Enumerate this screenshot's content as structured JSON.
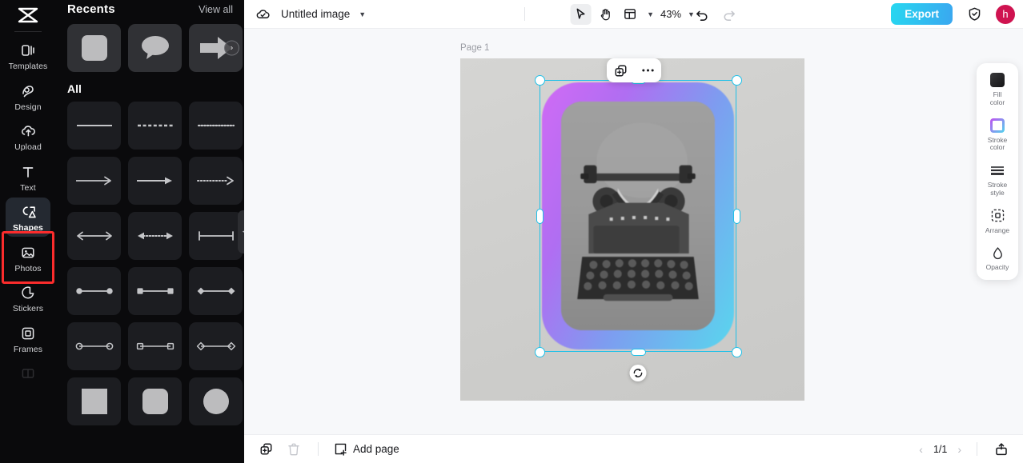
{
  "app": {
    "logo_icon": "capcut-logo-icon"
  },
  "sidebar": {
    "items": [
      {
        "label": "Templates",
        "icon": "templates-icon"
      },
      {
        "label": "Design",
        "icon": "design-icon"
      },
      {
        "label": "Upload",
        "icon": "upload-cloud-icon"
      },
      {
        "label": "Text",
        "icon": "text-icon"
      },
      {
        "label": "Shapes",
        "icon": "shapes-icon"
      },
      {
        "label": "Photos",
        "icon": "photos-icon"
      },
      {
        "label": "Stickers",
        "icon": "stickers-icon"
      },
      {
        "label": "Frames",
        "icon": "frames-icon"
      }
    ],
    "active": "Shapes",
    "highlight_color": "#fb2c2c"
  },
  "panel": {
    "title": "Recents",
    "view_all": "View all",
    "section_all": "All",
    "collapse_icon": "chevron-left-icon",
    "recents": [
      {
        "name": "rounded-square-shape"
      },
      {
        "name": "speech-bubble-shape"
      },
      {
        "name": "block-arrow-shape"
      }
    ],
    "recents_next_icon": "chevron-right-icon",
    "all_shapes": [
      {
        "name": "solid-line-shape"
      },
      {
        "name": "dashed-line-shape"
      },
      {
        "name": "dotted-line-shape"
      },
      {
        "name": "thin-arrow-shape"
      },
      {
        "name": "solid-arrow-shape"
      },
      {
        "name": "dotted-arrow-shape"
      },
      {
        "name": "double-arrow-shape"
      },
      {
        "name": "dotted-double-arrow-shape"
      },
      {
        "name": "bar-ends-line-shape"
      },
      {
        "name": "circle-ends-filled-shape"
      },
      {
        "name": "square-ends-filled-shape"
      },
      {
        "name": "diamond-ends-filled-shape"
      },
      {
        "name": "circle-ends-outline-shape"
      },
      {
        "name": "square-ends-outline-shape"
      },
      {
        "name": "diamond-ends-outline-shape"
      },
      {
        "name": "square-shape"
      },
      {
        "name": "rounded-rect-shape"
      },
      {
        "name": "circle-shape"
      }
    ]
  },
  "topbar": {
    "cloud_icon": "cloud-saved-icon",
    "doc_title": "Untitled image",
    "title_caret": "chevron-down-icon",
    "tools": [
      {
        "name": "select-tool",
        "icon": "cursor-arrow-icon",
        "active": true
      },
      {
        "name": "hand-tool",
        "icon": "hand-icon",
        "active": false
      },
      {
        "name": "layout-tool",
        "icon": "layout-grid-icon",
        "active": false
      }
    ],
    "layout_caret": "chevron-down-icon",
    "zoom": "43%",
    "zoom_caret": "chevron-down-icon",
    "undo_icon": "undo-arrow-icon",
    "redo_icon": "redo-arrow-icon",
    "export_label": "Export",
    "export_color": "#27d7f0",
    "shield_icon": "shield-check-icon",
    "avatar_initial": "h",
    "avatar_color": "#cf1350"
  },
  "canvas": {
    "page_label": "Page 1",
    "float_toolbar": [
      {
        "name": "duplicate-button",
        "icon": "duplicate-icon"
      },
      {
        "name": "more-options-button",
        "icon": "ellipsis-icon"
      }
    ],
    "selection": {
      "shape": "rounded-rectangle",
      "stroke_gradient_from": "#d06bf5",
      "stroke_gradient_to": "#59d6ee",
      "handle_color": "#1ec0e8",
      "content": "vintage-typewriter-photo"
    },
    "rotate_icon": "rotate-icon"
  },
  "props": {
    "items": [
      {
        "label": "Fill\ncolor",
        "l1": "Fill",
        "l2": "color",
        "icon": "fill-color-swatch"
      },
      {
        "label": "Stroke color",
        "l1": "Stroke",
        "l2": "color",
        "icon": "stroke-color-swatch"
      },
      {
        "label": "Stroke style",
        "l1": "Stroke",
        "l2": "style",
        "icon": "stroke-style-icon"
      },
      {
        "label": "Arrange",
        "l1": "Arrange",
        "l2": "",
        "icon": "arrange-icon"
      },
      {
        "label": "Opacity",
        "l1": "Opacity",
        "l2": "",
        "icon": "opacity-icon"
      }
    ]
  },
  "bottombar": {
    "duplicate_icon": "duplicate-page-icon",
    "delete_icon": "trash-icon",
    "add_page_label": "Add page",
    "add_page_icon": "add-page-icon",
    "prev_icon": "chevron-left-icon",
    "page_indicator": "1/1",
    "next_icon": "chevron-right-icon",
    "share_icon": "export-share-icon"
  }
}
